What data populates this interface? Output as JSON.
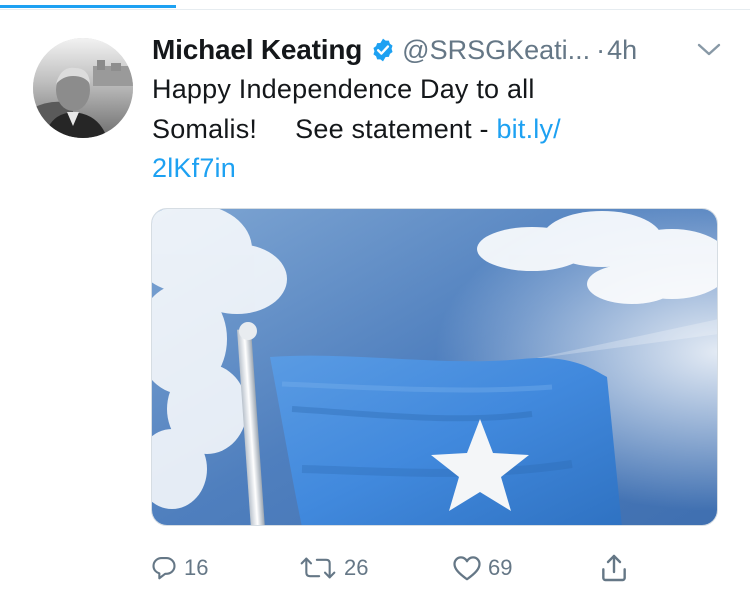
{
  "tweet": {
    "display_name": "Michael Keating",
    "handle": "@SRSGKeati...",
    "separator": "·",
    "time": "4h",
    "text_line1": "Happy Independence Day to all",
    "text_line2a": "Somalis!",
    "text_line2b": "See statement -",
    "link_part1": "bit.ly/",
    "link_part2": "2lKf7in"
  },
  "actions": {
    "reply_count": "16",
    "retweet_count": "26",
    "like_count": "69"
  },
  "icons": {
    "verified": "verified-badge-icon",
    "menu": "chevron-down-icon",
    "reply": "reply-icon",
    "retweet": "retweet-icon",
    "like": "heart-icon",
    "share": "share-icon"
  },
  "colors": {
    "accent": "#1da1f2",
    "text": "#14171a",
    "secondary": "#657786",
    "flag_blue": "#4189dd"
  }
}
